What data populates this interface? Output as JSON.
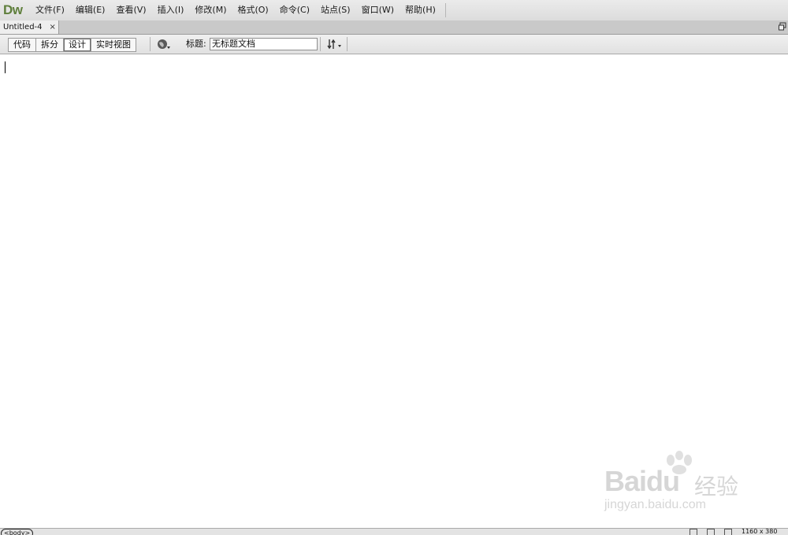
{
  "app": {
    "logo": "Dw"
  },
  "menu": {
    "items": [
      {
        "label": "文件(F)"
      },
      {
        "label": "编辑(E)"
      },
      {
        "label": "查看(V)"
      },
      {
        "label": "插入(I)"
      },
      {
        "label": "修改(M)"
      },
      {
        "label": "格式(O)"
      },
      {
        "label": "命令(C)"
      },
      {
        "label": "站点(S)"
      },
      {
        "label": "窗口(W)"
      },
      {
        "label": "帮助(H)"
      }
    ]
  },
  "tabs": {
    "document": {
      "label": "Untitled-4",
      "close": "×"
    },
    "restore_icon": "restore-icon"
  },
  "toolbar": {
    "views": [
      {
        "label": "代码",
        "active": false
      },
      {
        "label": "拆分",
        "active": false
      },
      {
        "label": "设计",
        "active": true
      },
      {
        "label": "实时视图",
        "active": false
      }
    ],
    "globe_icon": "globe-icon",
    "title_label": "标题:",
    "title_value": "无标题文档",
    "transfer_icon": "file-transfer-icon"
  },
  "status": {
    "tag": "<body>",
    "dimensions": "1160 x 380"
  },
  "watermark": {
    "brand": "Baidu",
    "cn": "经验",
    "url": "jingyan.baidu.com"
  }
}
